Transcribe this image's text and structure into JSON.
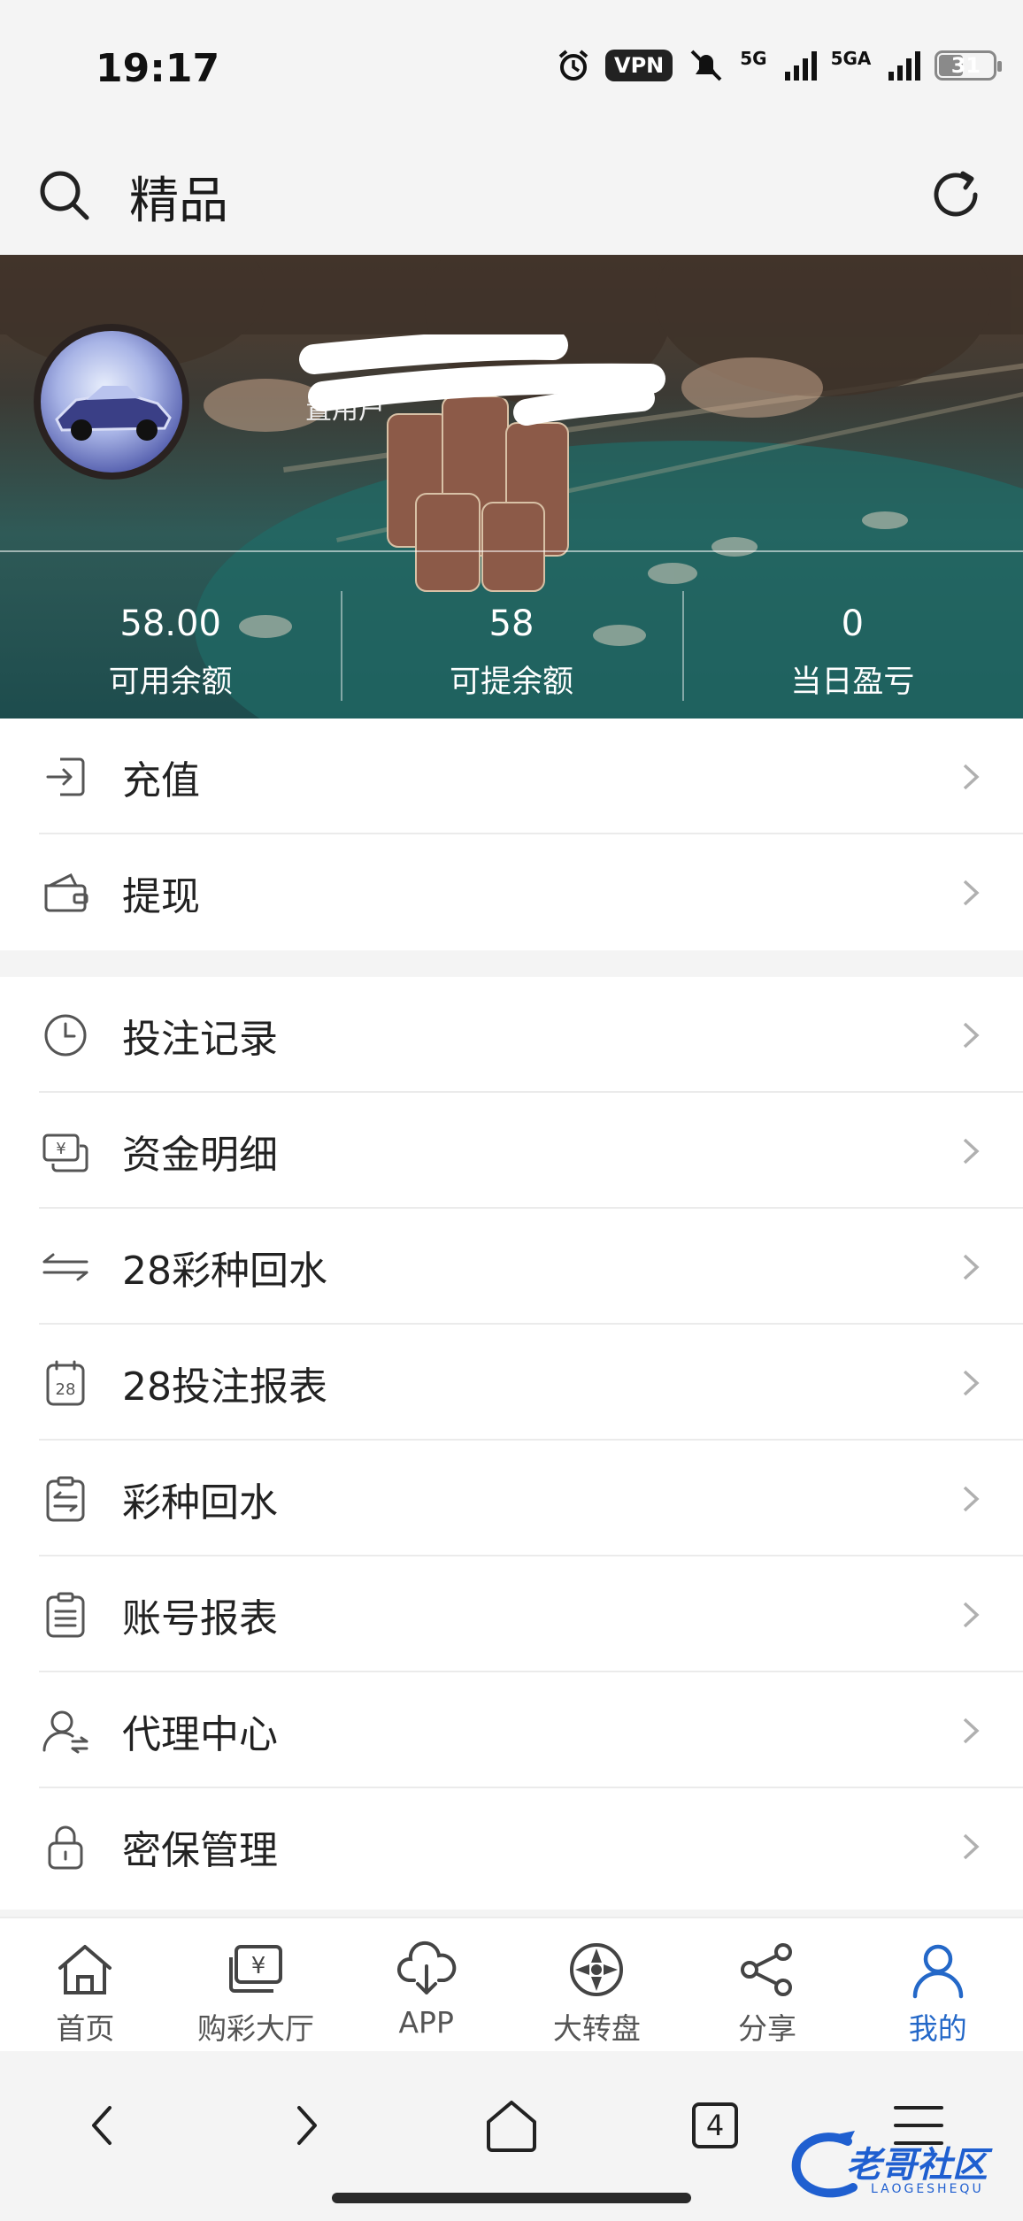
{
  "status_bar": {
    "time": "19:17",
    "vpn": "VPN",
    "network1": "5G",
    "network2": "5GA",
    "battery": "31",
    "icons": [
      "alarm-icon",
      "mute-icon",
      "signal-icon",
      "battery-icon"
    ]
  },
  "header": {
    "title": "精品",
    "search_icon": "search-icon",
    "refresh_icon": "refresh-icon"
  },
  "profile": {
    "username_visible": "置用户",
    "avatar": "car-avatar"
  },
  "stats": [
    {
      "value": "58.00",
      "label": "可用余额"
    },
    {
      "value": "58",
      "label": "可提余额"
    },
    {
      "value": "0",
      "label": "当日盈亏"
    }
  ],
  "menu_group1": [
    {
      "label": "充值",
      "icon": "recharge-icon"
    },
    {
      "label": "提现",
      "icon": "wallet-icon"
    }
  ],
  "menu_group2": [
    {
      "label": "投注记录",
      "icon": "clock-icon"
    },
    {
      "label": "资金明细",
      "icon": "money-icon"
    },
    {
      "label": "28彩种回水",
      "icon": "exchange-icon"
    },
    {
      "label": "28投注报表",
      "icon": "calendar-28-icon"
    },
    {
      "label": "彩种回水",
      "icon": "clipboard-exchange-icon"
    },
    {
      "label": "账号报表",
      "icon": "clipboard-icon"
    },
    {
      "label": "代理中心",
      "icon": "agent-icon"
    },
    {
      "label": "密保管理",
      "icon": "lock-icon"
    }
  ],
  "bottom_nav": [
    {
      "label": "首页",
      "icon": "home-icon"
    },
    {
      "label": "购彩大厅",
      "icon": "lottery-icon"
    },
    {
      "label": "APP",
      "icon": "cloud-download-icon"
    },
    {
      "label": "大转盘",
      "icon": "wheel-icon"
    },
    {
      "label": "分享",
      "icon": "share-icon"
    },
    {
      "label": "我的",
      "icon": "user-icon",
      "active": true
    }
  ],
  "browser_bar": {
    "tab_count": "4",
    "watermark": "老哥社区",
    "watermark_sub": "LAOGESHEQU"
  },
  "colors": {
    "accent": "#2468c8",
    "text": "#222222",
    "chevron": "#b0b0b0"
  }
}
